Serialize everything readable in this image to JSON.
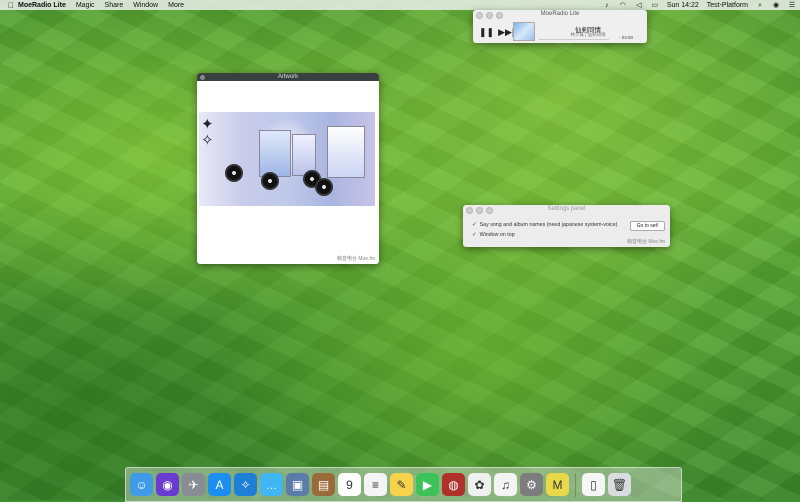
{
  "menubar": {
    "app_name": "MoeRadio Lite",
    "items": [
      "Magic",
      "Share",
      "Window",
      "More"
    ],
    "clock": "Sun 14:22",
    "user": "Test-Platform"
  },
  "player": {
    "title": "MoeRadio Lite",
    "song": "仙剣同情",
    "artist": "林夕眞 | 仙剣同情",
    "time": "- 04:00"
  },
  "artwork": {
    "title": "Artwork",
    "footer": "萌音电台 Moe.fm"
  },
  "settings": {
    "title": "Settings panel",
    "option_say_names": "Say song and album names (need japanese system-voice)",
    "option_window_top": "Window on top",
    "go_button": "Go to set!",
    "footer": "萌音电台 Moe.fm"
  },
  "dock": {
    "apps": [
      {
        "icon": "finder-icon",
        "color": "#3f9ae8",
        "glyph": "☺"
      },
      {
        "icon": "siri-icon",
        "color": "#6a3bd1",
        "glyph": "◉"
      },
      {
        "icon": "launchpad-icon",
        "color": "#888c95",
        "glyph": "✈"
      },
      {
        "icon": "app-store-icon",
        "color": "#1b8ff0",
        "glyph": "A"
      },
      {
        "icon": "safari-icon",
        "color": "#1e7fd6",
        "glyph": "✧"
      },
      {
        "icon": "messages-icon",
        "color": "#40b6f5",
        "glyph": "…"
      },
      {
        "icon": "preview-icon",
        "color": "#5a7ca8",
        "glyph": "▣"
      },
      {
        "icon": "notebook-icon",
        "color": "#9a6a3a",
        "glyph": "▤"
      },
      {
        "icon": "calendar-icon",
        "color": "#ffffff",
        "glyph": "9"
      },
      {
        "icon": "reminders-icon",
        "color": "#f4f4f4",
        "glyph": "≡"
      },
      {
        "icon": "notes-icon",
        "color": "#f7d34c",
        "glyph": "✎"
      },
      {
        "icon": "facetime-icon",
        "color": "#3cc35a",
        "glyph": "▶"
      },
      {
        "icon": "photo-booth-icon",
        "color": "#b0302a",
        "glyph": "◍"
      },
      {
        "icon": "photos-icon",
        "color": "#f0f0f0",
        "glyph": "✿"
      },
      {
        "icon": "music-icon",
        "color": "#f4f4f4",
        "glyph": "♫"
      },
      {
        "icon": "system-preferences-icon",
        "color": "#7d7d80",
        "glyph": "⚙"
      },
      {
        "icon": "moeradio-icon",
        "color": "#e8d84a",
        "glyph": "M"
      }
    ],
    "extras": [
      {
        "icon": "document-icon",
        "color": "#f6f6f6",
        "glyph": "▯"
      },
      {
        "icon": "trash-icon",
        "color": "#d9dde0",
        "glyph": "🗑"
      }
    ]
  }
}
